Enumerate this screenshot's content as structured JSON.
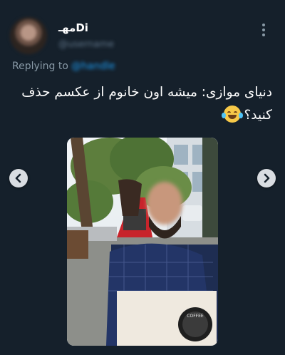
{
  "tweet": {
    "author_name": "مهـDi",
    "author_handle": "@username",
    "replying_label": "Replying to",
    "replying_handle": "@handle",
    "text_line1": "دنیای موازی: میشه اون خانوم از عکسم حذف",
    "text_line2": "کنید؟",
    "emoji": "face-with-tears-of-joy"
  },
  "controls": {
    "prev_icon": "chevron-left-icon",
    "next_icon": "chevron-right-icon",
    "more_icon": "more-vertical-icon"
  },
  "photo": {
    "description_icon": "photo",
    "cup_brand": "COFFEE"
  },
  "colors": {
    "background": "#15202b",
    "secondary_text": "#8899a6",
    "accent": "#1d9bf0"
  }
}
